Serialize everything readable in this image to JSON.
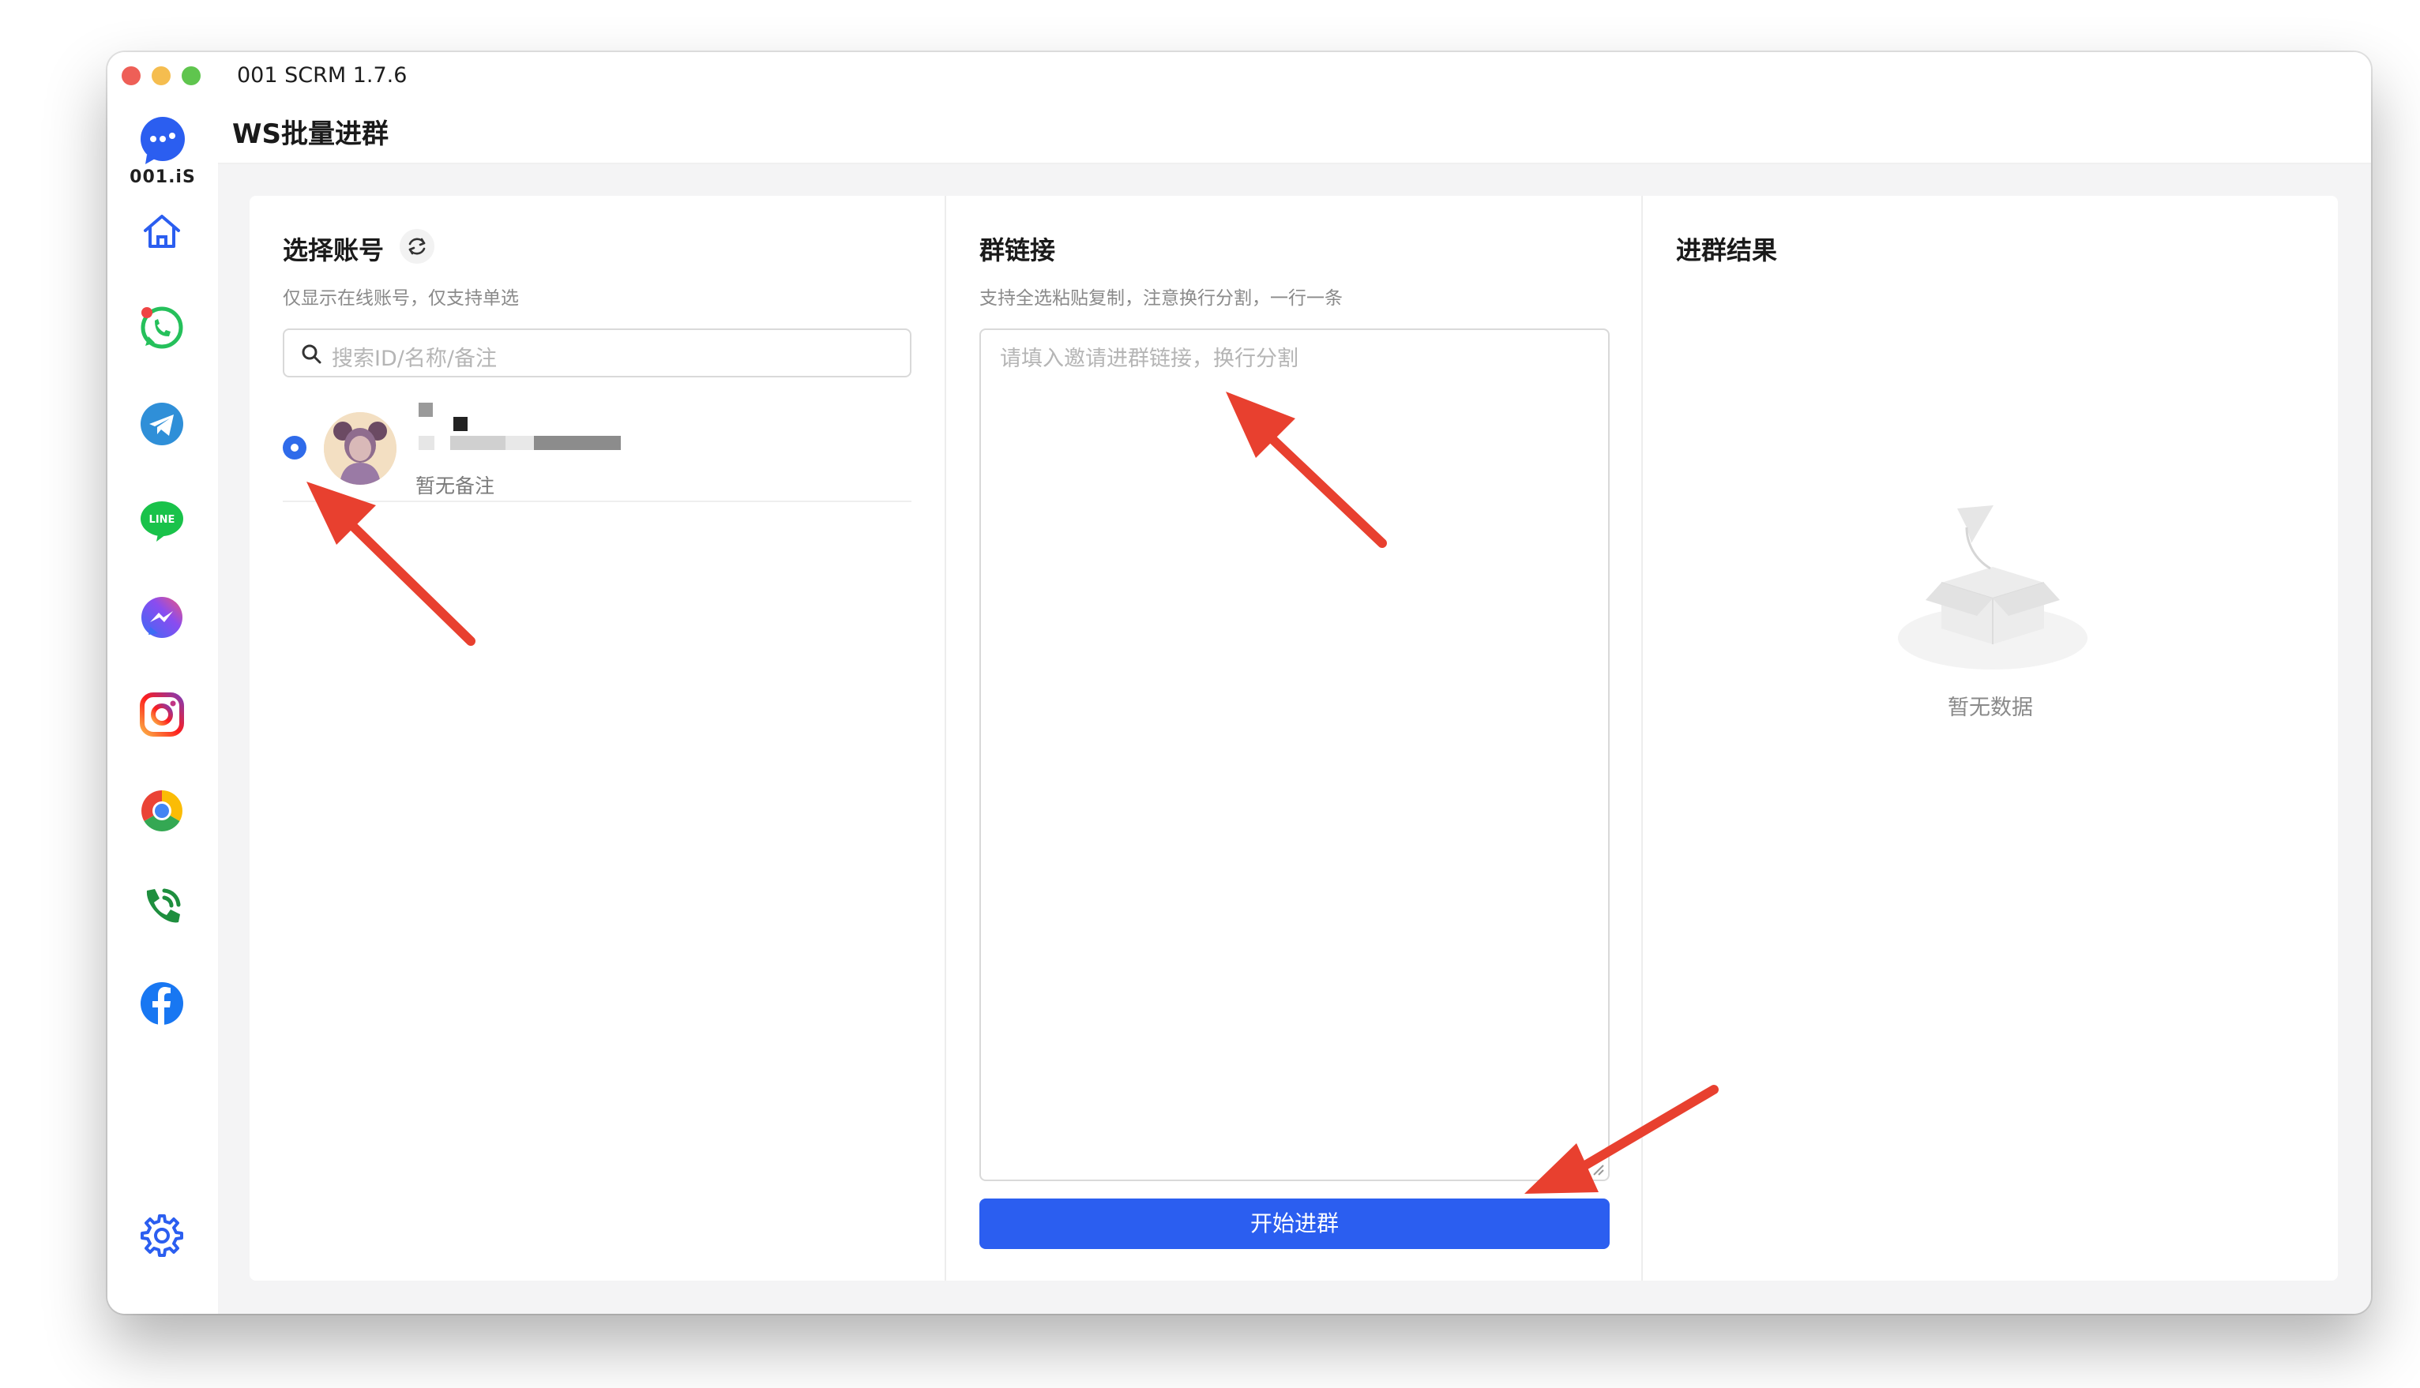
{
  "window": {
    "title": "001 SCRM 1.7.6"
  },
  "sidebar": {
    "logo_text": "001.iS",
    "items": [
      {
        "icon": "home-icon"
      },
      {
        "icon": "whatsapp-icon"
      },
      {
        "icon": "telegram-icon"
      },
      {
        "icon": "line-icon",
        "label": "LINE"
      },
      {
        "icon": "messenger-icon"
      },
      {
        "icon": "instagram-icon"
      },
      {
        "icon": "chrome-icon"
      },
      {
        "icon": "phone-icon"
      },
      {
        "icon": "facebook-icon"
      }
    ],
    "settings_icon": "gear-icon"
  },
  "header": {
    "title": "WS批量进群"
  },
  "left_panel": {
    "title": "选择账号",
    "subtitle": "仅显示在线账号，仅支持单选",
    "search_placeholder": "搜索ID/名称/备注",
    "account": {
      "note": "暂无备注",
      "selected": true
    }
  },
  "mid_panel": {
    "title": "群链接",
    "subtitle": "支持全选粘贴复制，注意换行分割，一行一条",
    "textarea_placeholder": "请填入邀请进群链接，换行分割",
    "start_button": "开始进群"
  },
  "right_panel": {
    "title": "进群结果",
    "empty_text": "暂无数据"
  },
  "colors": {
    "primary": "#2b5ef0",
    "annotation_arrow": "#e8402f",
    "background": "#f4f4f5"
  }
}
